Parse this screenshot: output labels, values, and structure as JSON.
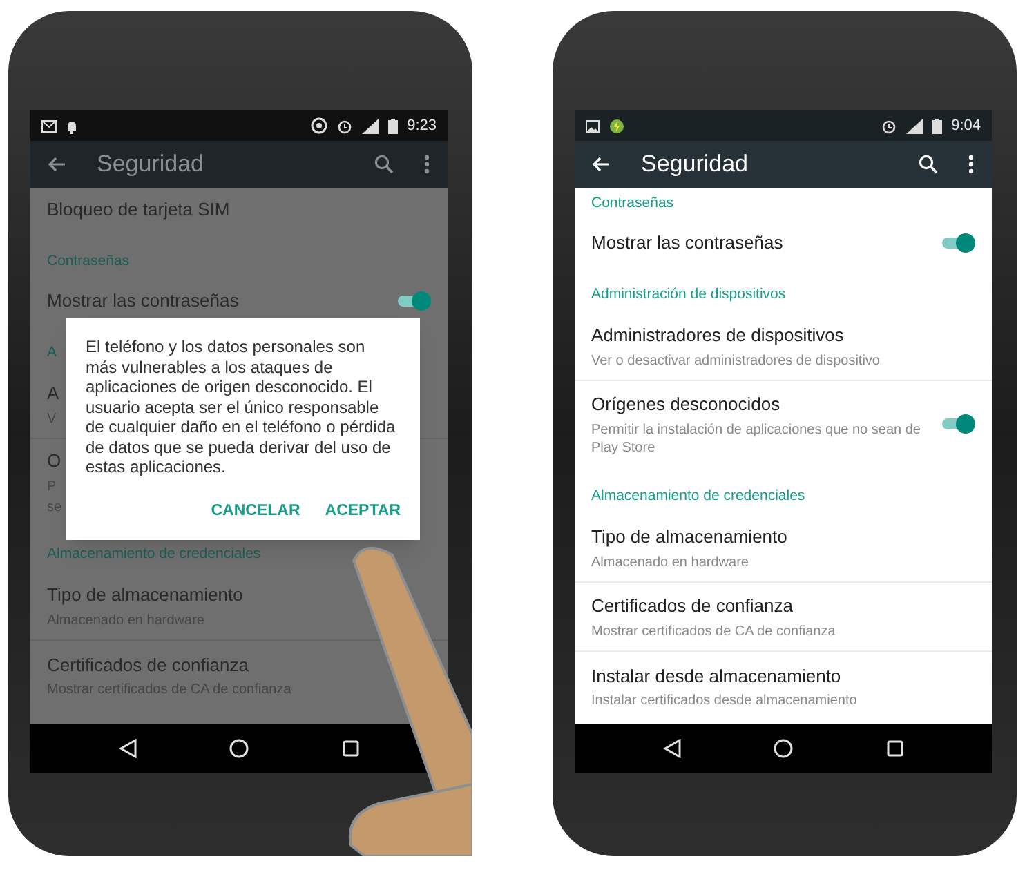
{
  "phones": [
    {
      "dimmed": true,
      "status_bar": {
        "time": "9:23"
      },
      "toolbar": {
        "title": "Seguridad"
      },
      "list": [
        {
          "kind": "item",
          "title": "Bloqueo de tarjeta SIM"
        },
        {
          "kind": "header",
          "text": "Contraseñas"
        },
        {
          "kind": "switch",
          "title": "Mostrar las contraseñas",
          "on": true
        },
        {
          "kind": "header",
          "text": "A"
        },
        {
          "kind": "item",
          "title": "A",
          "subtitle": "V"
        },
        {
          "kind": "item",
          "title": "O",
          "subtitle": "P",
          "subtitle_2": "se"
        },
        {
          "kind": "header",
          "text": "Almacenamiento de credenciales"
        },
        {
          "kind": "item",
          "title": "Tipo de almacenamiento",
          "subtitle": "Almacenado en hardware"
        },
        {
          "kind": "item",
          "title": "Certificados de confianza",
          "subtitle": "Mostrar certificados de CA de confianza"
        }
      ],
      "dialog": {
        "message": "El teléfono y los datos personales son más vulnerables a los ataques de aplicaciones de origen desconocido. El usuario acepta ser el único responsable de cualquier daño en el teléfono o pérdida de datos que se pueda derivar del uso de estas aplicaciones.",
        "buttons": [
          "CANCELAR",
          "ACEPTAR"
        ]
      }
    },
    {
      "dimmed": false,
      "status_bar": {
        "time": "9:04"
      },
      "toolbar": {
        "title": "Seguridad"
      },
      "list": [
        {
          "kind": "header",
          "text": "Contraseñas"
        },
        {
          "kind": "switch",
          "title": "Mostrar las contraseñas",
          "on": true
        },
        {
          "kind": "header",
          "text": "Administración de dispositivos"
        },
        {
          "kind": "item",
          "title": "Administradores de dispositivos",
          "subtitle": "Ver o desactivar administradores de dispositivo"
        },
        {
          "kind": "switch",
          "title": "Orígenes desconocidos",
          "subtitle": "Permitir la instalación de aplicaciones que no sean de Play Store",
          "on": true
        },
        {
          "kind": "header",
          "text": "Almacenamiento de credenciales"
        },
        {
          "kind": "item",
          "title": "Tipo de almacenamiento",
          "subtitle": "Almacenado en hardware"
        },
        {
          "kind": "item",
          "title": "Certificados de confianza",
          "subtitle": "Mostrar certificados de CA de confianza"
        },
        {
          "kind": "item",
          "title": "Instalar desde almacenamiento",
          "subtitle": "Instalar certificados desde almacenamiento"
        }
      ]
    }
  ]
}
